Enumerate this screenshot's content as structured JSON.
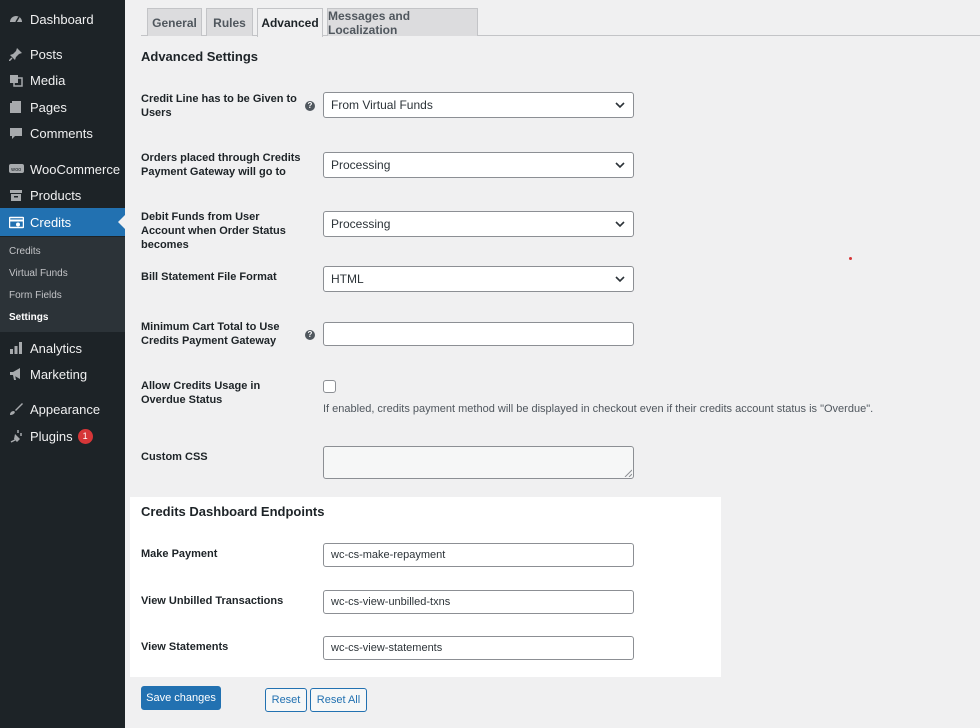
{
  "sidebar": {
    "menu": [
      {
        "label": "Dashboard",
        "icon": "dashboard-icon"
      },
      {
        "label": "Posts",
        "icon": "pin-icon"
      },
      {
        "label": "Media",
        "icon": "media-icon"
      },
      {
        "label": "Pages",
        "icon": "pages-icon"
      },
      {
        "label": "Comments",
        "icon": "comments-icon"
      },
      {
        "label": "WooCommerce",
        "icon": "woocommerce-icon"
      },
      {
        "label": "Products",
        "icon": "archive-icon"
      },
      {
        "label": "Credits",
        "icon": "credits-icon",
        "active": true
      },
      {
        "label": "Analytics",
        "icon": "bar-chart-icon"
      },
      {
        "label": "Marketing",
        "icon": "megaphone-icon"
      },
      {
        "label": "Appearance",
        "icon": "paintbrush-icon"
      },
      {
        "label": "Plugins",
        "icon": "plug-icon",
        "badge": "1"
      }
    ],
    "submenu": [
      "Credits",
      "Virtual Funds",
      "Form Fields",
      "Settings"
    ],
    "current_submenu": "Settings"
  },
  "tabs": [
    "General",
    "Rules",
    "Advanced",
    "Messages and Localization"
  ],
  "active_tab": "Advanced",
  "advanced": {
    "heading": "Advanced Settings",
    "credit_line": {
      "label": "Credit Line has to be Given to Users",
      "value": "From Virtual Funds"
    },
    "orders_status": {
      "label": "Orders placed through Credits Payment Gateway will go to",
      "value": "Processing"
    },
    "debit_status": {
      "label": "Debit Funds from User Account when Order Status becomes",
      "value": "Processing"
    },
    "bill_format": {
      "label": "Bill Statement File Format",
      "value": "HTML"
    },
    "min_cart": {
      "label": "Minimum Cart Total to Use Credits Payment Gateway",
      "value": ""
    },
    "overdue": {
      "label": "Allow Credits Usage in Overdue Status",
      "checked": false,
      "description": "If enabled, credits payment method will be displayed in checkout even if their credits account status is \"Overdue\"."
    },
    "custom_css": {
      "label": "Custom CSS",
      "value": ""
    }
  },
  "endpoints": {
    "heading": "Credits Dashboard Endpoints",
    "make_payment": {
      "label": "Make Payment",
      "value": "wc-cs-make-repayment"
    },
    "unbilled": {
      "label": "View Unbilled Transactions",
      "value": "wc-cs-view-unbilled-txns"
    },
    "statements": {
      "label": "View Statements",
      "value": "wc-cs-view-statements"
    }
  },
  "buttons": {
    "save": "Save changes",
    "reset": "Reset",
    "reset_all": "Reset All"
  },
  "colors": {
    "accent": "#2271b1",
    "sidebar": "#1d2327",
    "badge": "#d63638"
  }
}
